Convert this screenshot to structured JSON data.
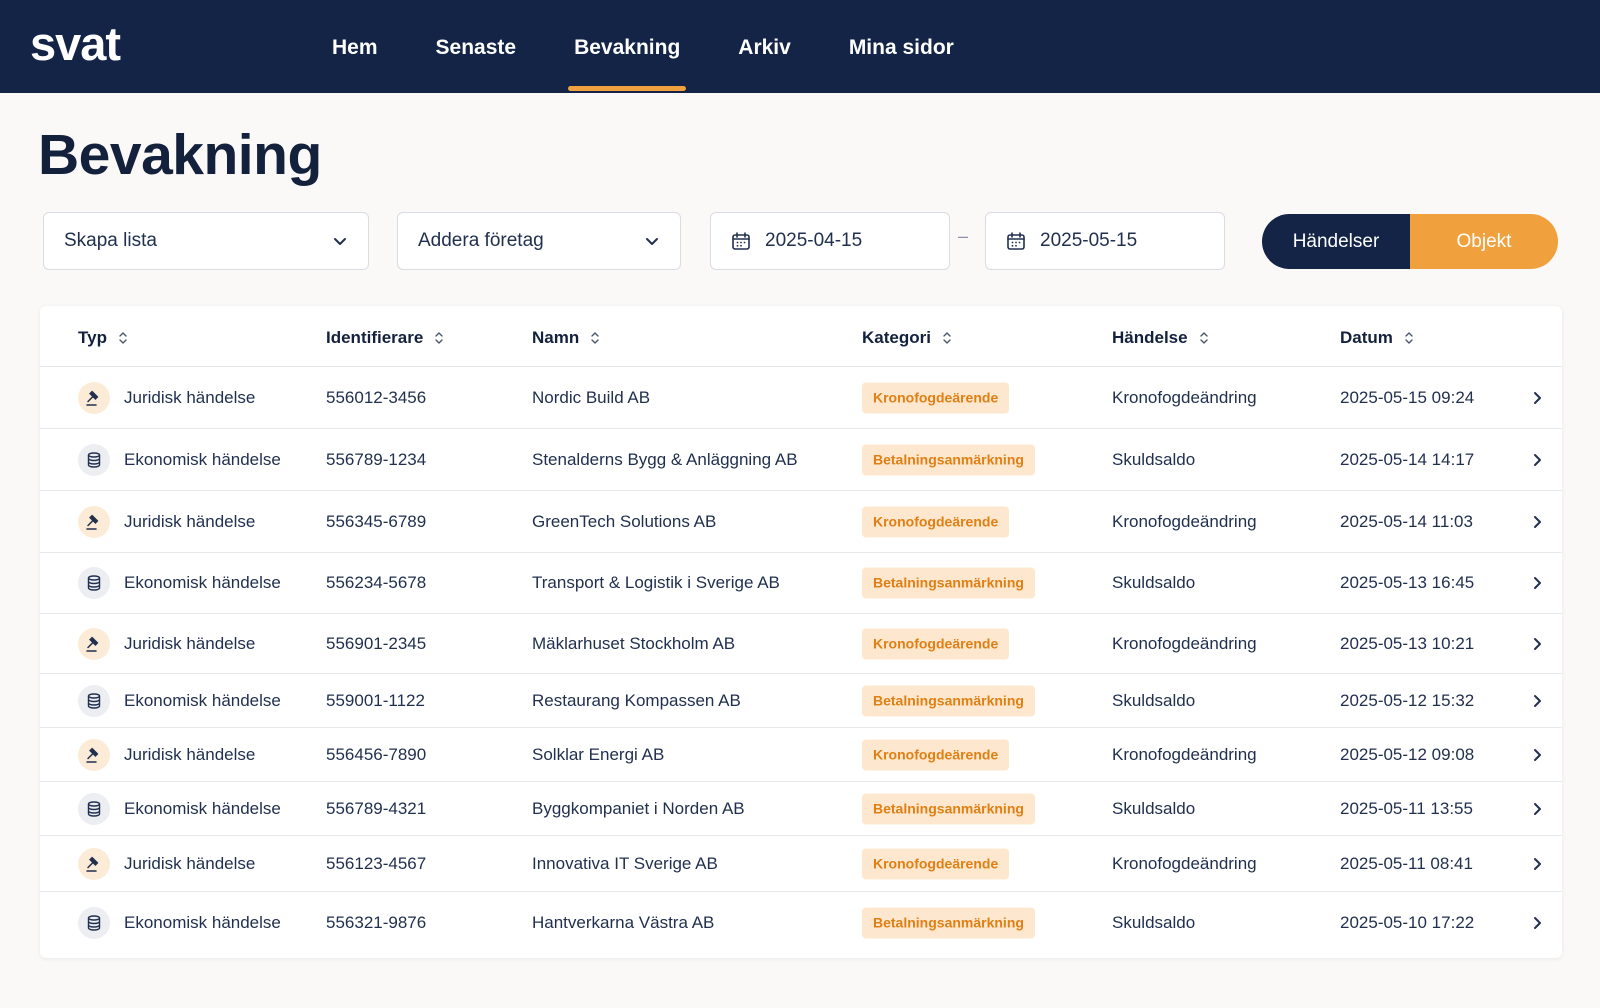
{
  "app": {
    "logo": "svat"
  },
  "nav": [
    {
      "label": "Hem",
      "active": false
    },
    {
      "label": "Senaste",
      "active": false
    },
    {
      "label": "Bevakning",
      "active": true
    },
    {
      "label": "Arkiv",
      "active": false
    },
    {
      "label": "Mina sidor",
      "active": false
    }
  ],
  "page": {
    "title": "Bevakning"
  },
  "filters": {
    "list_select": "Skapa lista",
    "company_select": "Addera företag",
    "date_from": "2025-04-15",
    "date_separator": "–",
    "date_to": "2025-05-15"
  },
  "view_toggle": {
    "events": "Händelser",
    "objects": "Objekt"
  },
  "table": {
    "columns": [
      "Typ",
      "Identifierare",
      "Namn",
      "Kategori",
      "Händelse",
      "Datum"
    ],
    "rows": [
      {
        "kind": "jur",
        "type": "Juridisk händelse",
        "id": "556012-3456",
        "name": "Nordic Build AB",
        "category": "Kronofogdeärende",
        "event": "Kronofogdeändring",
        "date": "2025-05-15 09:24"
      },
      {
        "kind": "eko",
        "type": "Ekonomisk händelse",
        "id": "556789-1234",
        "name": "Stenalderns Bygg & Anläggning AB",
        "category": "Betalningsanmärkning",
        "event": "Skuldsaldo",
        "date": "2025-05-14 14:17"
      },
      {
        "kind": "jur",
        "type": "Juridisk händelse",
        "id": "556345-6789",
        "name": "GreenTech Solutions AB",
        "category": "Kronofogdeärende",
        "event": "Kronofogdeändring",
        "date": "2025-05-14 11:03"
      },
      {
        "kind": "eko",
        "type": "Ekonomisk händelse",
        "id": "556234-5678",
        "name": "Transport & Logistik i Sverige AB",
        "category": "Betalningsanmärkning",
        "event": "Skuldsaldo",
        "date": "2025-05-13 16:45"
      },
      {
        "kind": "jur",
        "type": "Juridisk händelse",
        "id": "556901-2345",
        "name": "Mäklarhuset Stockholm AB",
        "category": "Kronofogdeärende",
        "event": "Kronofogdeändring",
        "date": "2025-05-13 10:21"
      },
      {
        "kind": "eko",
        "type": "Ekonomisk händelse",
        "id": "559001-1122",
        "name": "Restaurang Kompassen AB",
        "category": "Betalningsanmärkning",
        "event": "Skuldsaldo",
        "date": "2025-05-12 15:32"
      },
      {
        "kind": "jur",
        "type": "Juridisk händelse",
        "id": "556456-7890",
        "name": "Solklar Energi AB",
        "category": "Kronofogdeärende",
        "event": "Kronofogdeändring",
        "date": "2025-05-12 09:08"
      },
      {
        "kind": "eko",
        "type": "Ekonomisk händelse",
        "id": "556789-4321",
        "name": "Byggkompaniet i Norden AB",
        "category": "Betalningsanmärkning",
        "event": "Skuldsaldo",
        "date": "2025-05-11 13:55"
      },
      {
        "kind": "jur",
        "type": "Juridisk händelse",
        "id": "556123-4567",
        "name": "Innovativa IT Sverige AB",
        "category": "Kronofogdeärende",
        "event": "Kronofogdeändring",
        "date": "2025-05-11 08:41"
      },
      {
        "kind": "eko",
        "type": "Ekonomisk händelse",
        "id": "556321-9876",
        "name": "Hantverkarna Västra AB",
        "category": "Betalningsanmärkning",
        "event": "Skuldsaldo",
        "date": "2025-05-10 17:22"
      }
    ]
  },
  "icons": {
    "juridisk": "gavel-icon",
    "ekonomisk": "database-icon",
    "calendar": "calendar-icon",
    "sort": "sort-icon",
    "row": "chevron-right-icon",
    "dropdown": "chevron-down-icon"
  },
  "colors": {
    "navy": "#132447",
    "accent": "#f0a03d",
    "badge_bg": "#fde8cf",
    "badge_text": "#e07f13",
    "background": "#faf9f7"
  }
}
